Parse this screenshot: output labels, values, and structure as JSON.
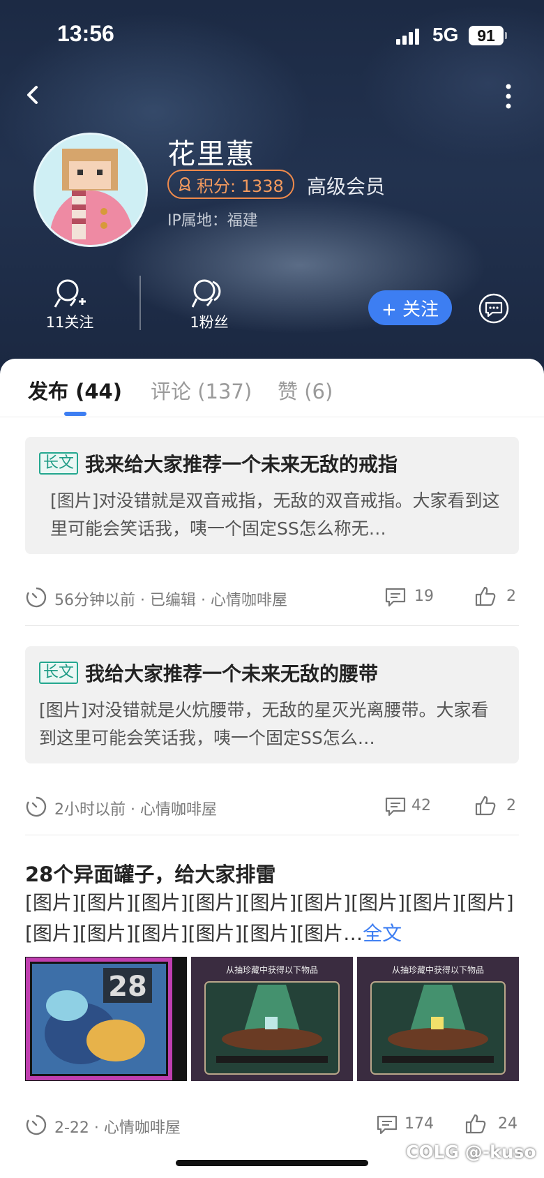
{
  "status": {
    "time": "13:56",
    "network": "5G",
    "battery": "91"
  },
  "profile": {
    "name": "花里蕙",
    "score_label": "积分: 1338",
    "member_level": "高级会员",
    "ip_location": "IP属地：福建",
    "following_label": "11关注",
    "fans_label": "1粉丝",
    "follow_button": "+ 关注"
  },
  "tabs": [
    {
      "label": "发布 (44)",
      "active": true
    },
    {
      "label": "评论 (137)",
      "active": false
    },
    {
      "label": "赞 (6)",
      "active": false
    }
  ],
  "posts": [
    {
      "tag": "长文",
      "title": "我来给大家推荐一个未来无敌的戒指",
      "excerpt": "[图片]对没错就是双音戒指，无敌的双音戒指。大家看到这里可能会笑话我，咦一个固定SS怎么称无…",
      "meta": "56分钟以前 · 已编辑 · 心情咖啡屋",
      "comments": "19",
      "likes": "2"
    },
    {
      "tag": "长文",
      "title": "我给大家推荐一个未来无敌的腰带",
      "excerpt": "[图片]对没错就是火炕腰带，无敌的星灭光离腰带。大家看到这里可能会笑话我，咦一个固定SS怎么…",
      "meta": "2小时以前 · 心情咖啡屋",
      "comments": "42",
      "likes": "2"
    },
    {
      "title": "28个异面罐子，给大家排雷",
      "body": "[图片][图片][图片][图片][图片][图片][图片][图片][图片][图片][图片][图片][图片][图片][图片…",
      "full_text": "全文",
      "thumb_number": "28",
      "thumb_caption": "从抽珍藏中获得以下物品",
      "meta": "2-22 · 心情咖啡屋",
      "comments": "174",
      "likes": "24"
    }
  ],
  "watermark": "COLG @-kuso",
  "colors": {
    "accent": "#3d7ef2",
    "score": "#f08a4b",
    "tag": "#23a78f"
  }
}
